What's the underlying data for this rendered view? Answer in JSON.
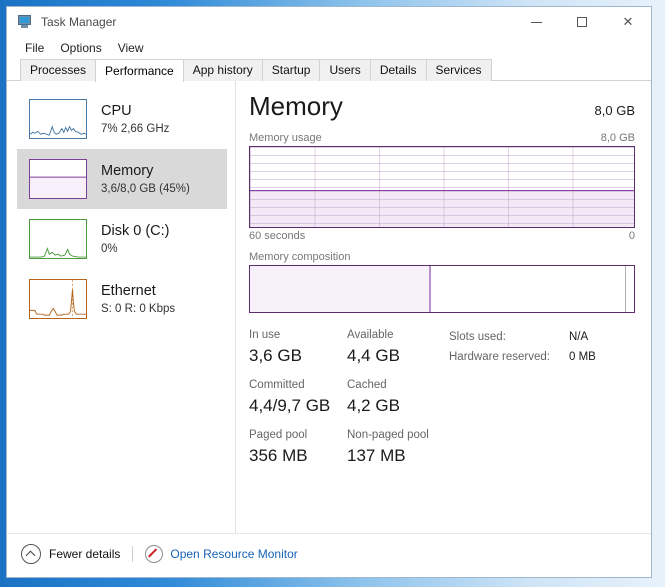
{
  "window": {
    "title": "Task Manager",
    "icon": "task-manager-icon",
    "controls": {
      "minimize": "–",
      "maximize": "□",
      "close": "✕"
    }
  },
  "menubar": {
    "items": [
      "File",
      "Options",
      "View"
    ]
  },
  "tabs": {
    "items": [
      "Processes",
      "Performance",
      "App history",
      "Startup",
      "Users",
      "Details",
      "Services"
    ],
    "active": "Performance"
  },
  "sidebar": {
    "items": [
      {
        "key": "cpu",
        "title": "CPU",
        "sub": "7%  2,66 GHz",
        "color": "#4a7ba7",
        "selected": false
      },
      {
        "key": "memory",
        "title": "Memory",
        "sub": "3,6/8,0 GB (45%)",
        "color": "#7b3f98",
        "selected": true
      },
      {
        "key": "disk",
        "title": "Disk 0 (C:)",
        "sub": "0%",
        "color": "#4e9a3f",
        "selected": false
      },
      {
        "key": "ethernet",
        "title": "Ethernet",
        "sub": "S: 0 R: 0 Kbps",
        "color": "#b5651d",
        "selected": false
      }
    ]
  },
  "main": {
    "title": "Memory",
    "total": "8,0 GB",
    "usage_section": {
      "label": "Memory usage",
      "max_label": "8,0 GB",
      "axis_left": "60 seconds",
      "axis_right": "0",
      "fill_percent": 45
    },
    "composition_section": {
      "label": "Memory composition",
      "in_use_percent": 46.5
    },
    "stats": [
      {
        "label": "In use",
        "value": "3,6 GB"
      },
      {
        "label": "Available",
        "value": "4,4 GB"
      },
      {
        "label": "Committed",
        "value": "4,4/9,7 GB"
      },
      {
        "label": "Cached",
        "value": "4,2 GB"
      },
      {
        "label": "Paged pool",
        "value": "356 MB"
      },
      {
        "label": "Non-paged pool",
        "value": "137 MB"
      }
    ],
    "details": [
      {
        "key": "Slots used:",
        "value": "N/A"
      },
      {
        "key": "Hardware reserved:",
        "value": "0 MB"
      }
    ]
  },
  "footer": {
    "fewer_details": "Fewer details",
    "fewer_icon": "chevron-up-circle-icon",
    "resource_monitor": "Open Resource Monitor",
    "resource_icon": "resource-monitor-icon"
  },
  "colors": {
    "memory_accent": "#5b2d6e",
    "memory_fill": "#f3e9f6",
    "link": "#1763b6",
    "selection": "#d9d9d9"
  }
}
